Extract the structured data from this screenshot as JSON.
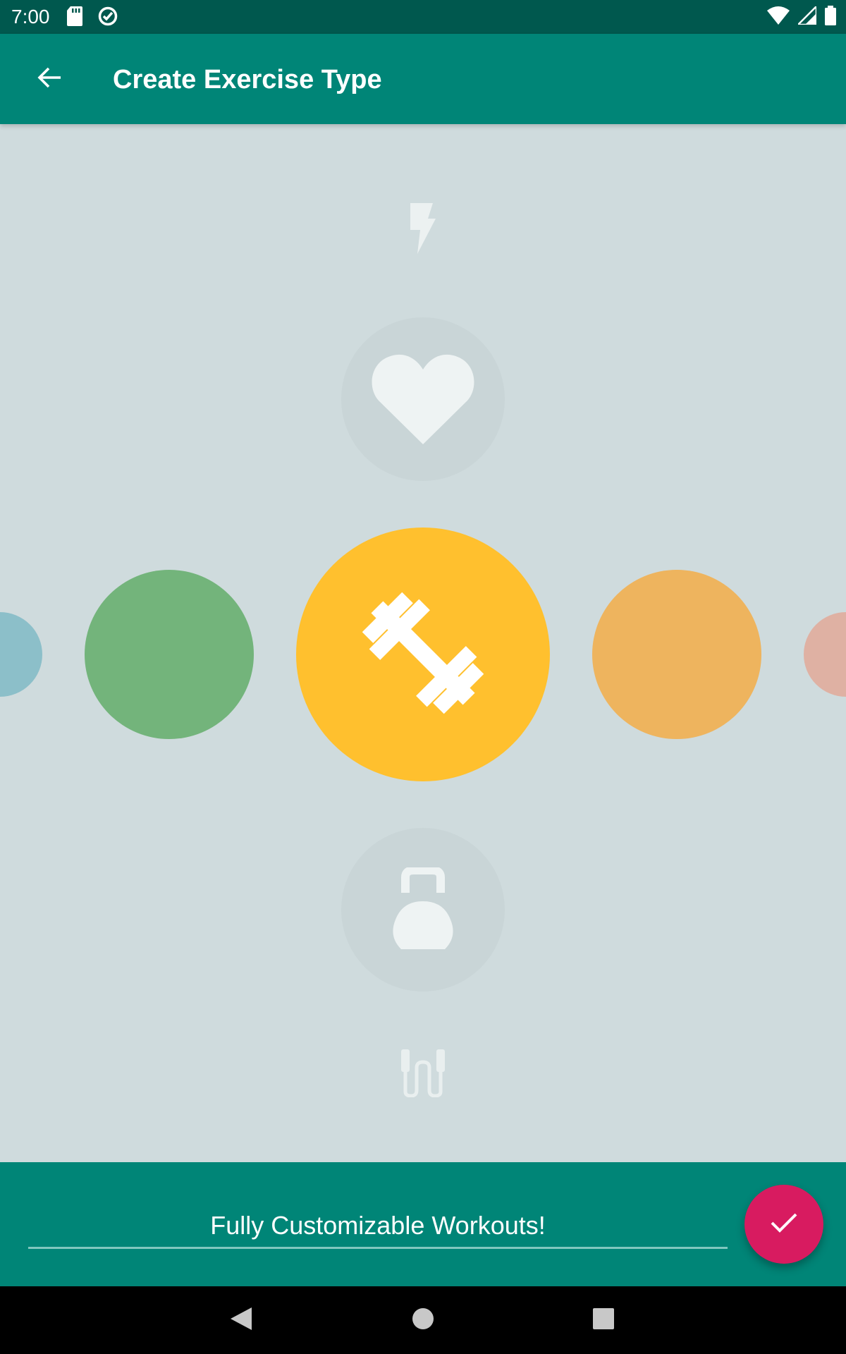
{
  "status_bar": {
    "time": "7:00",
    "left_icons": [
      "sd-card-icon",
      "sync-icon"
    ],
    "right_icons": [
      "wifi-icon",
      "signal-icon",
      "battery-icon"
    ]
  },
  "app_bar": {
    "title": "Create Exercise Type",
    "back_icon": "arrow-back-icon"
  },
  "icon_picker": {
    "items": [
      "lightning-icon",
      "heart-icon",
      "dumbbell-icon",
      "kettlebell-icon",
      "jump-rope-icon"
    ],
    "selected": "dumbbell-icon"
  },
  "color_picker": {
    "colors": [
      "#8CBFC9",
      "#73B47B",
      "#FFC02E",
      "#EEB45E",
      "#DFB1A3"
    ],
    "selected": "#FFC02E"
  },
  "bottom_bar": {
    "name_value": "Fully Customizable Workouts!",
    "accent": "#008577"
  },
  "fab": {
    "icon": "check-icon",
    "color": "#D81B60"
  },
  "nav_bar": {
    "icons": [
      "nav-back-icon",
      "nav-home-icon",
      "nav-recents-icon"
    ]
  }
}
